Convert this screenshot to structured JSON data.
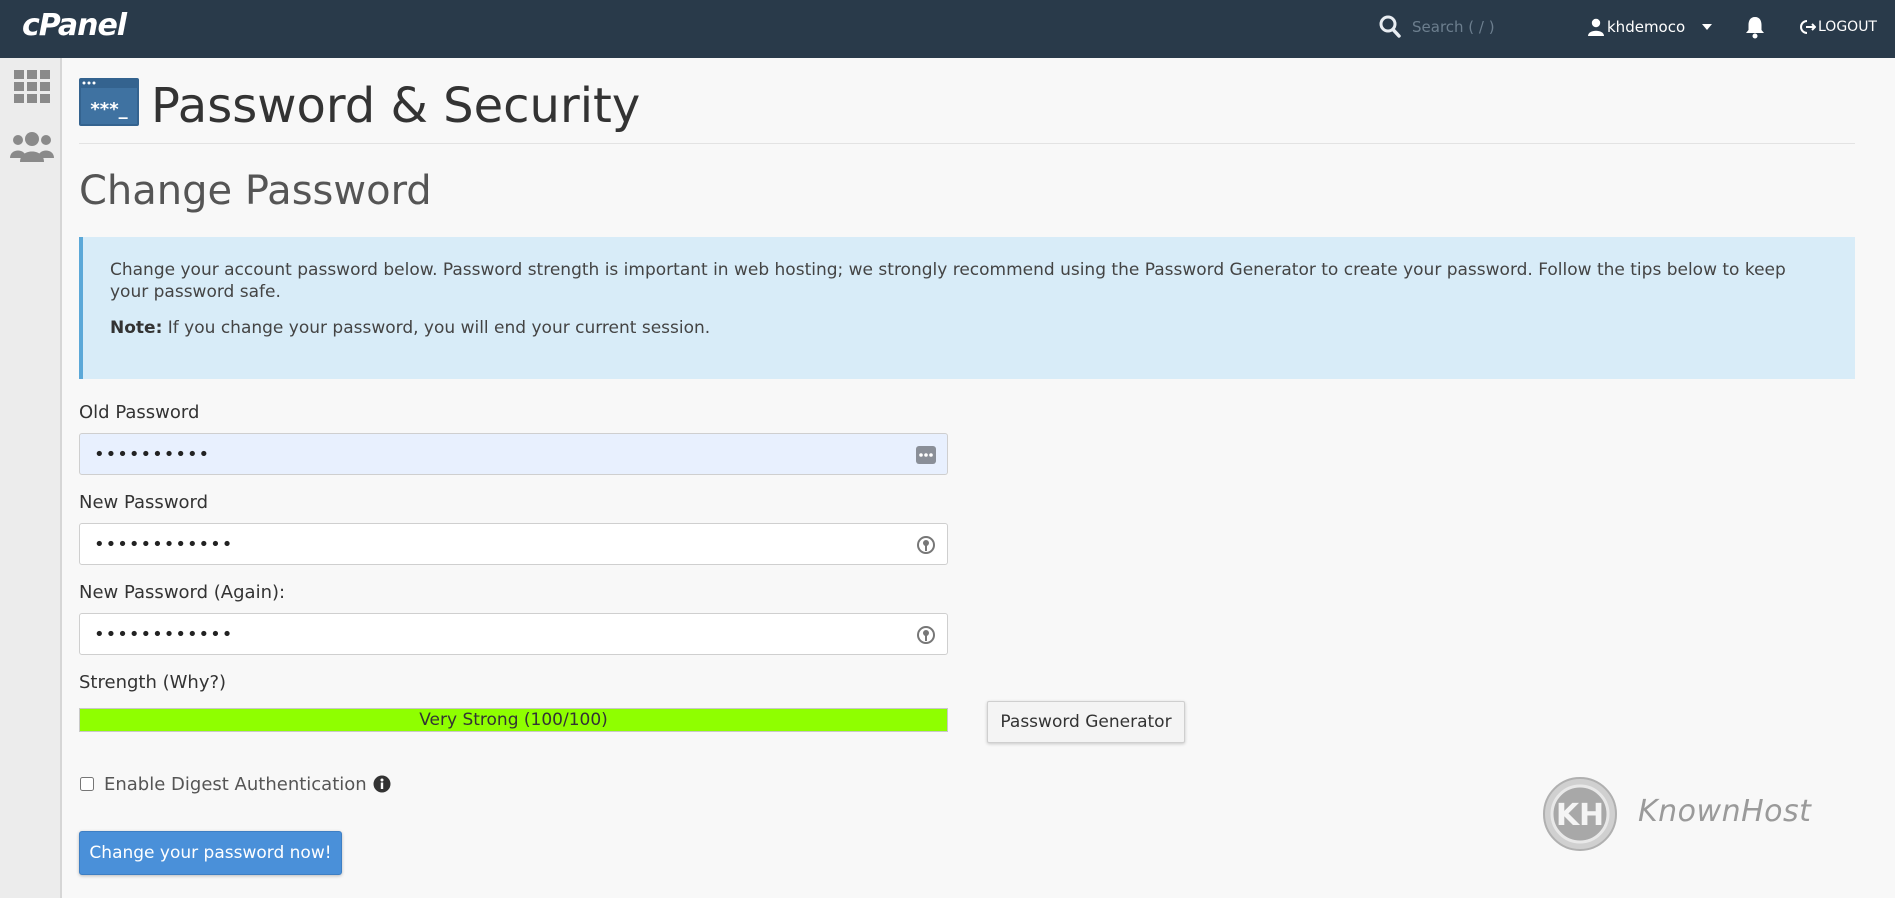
{
  "topbar": {
    "logo": "cPanel",
    "search_placeholder": "Search ( / )",
    "username": "khdemoco",
    "logout_label": "LOGOUT",
    "icons": {
      "search": "search-icon",
      "user": "user-icon",
      "caret": "caret-down-icon",
      "bell": "bell-icon",
      "logout": "logout-icon"
    }
  },
  "sidebar": {
    "items": [
      {
        "icon": "grid-icon"
      },
      {
        "icon": "users-icon"
      }
    ]
  },
  "page": {
    "title": "Password & Security",
    "icon": "password-security-icon",
    "icon_text": "***_"
  },
  "section": {
    "title": "Change Password"
  },
  "info": {
    "text": "Change your account password below. Password strength is important in web hosting; we strongly recommend using the Password Generator to create your password. Follow the tips below to keep your password safe.",
    "note_label": "Note:",
    "note_text": "If you change your password, you will end your current session."
  },
  "form": {
    "old_password": {
      "label": "Old Password",
      "value": "••••••••••"
    },
    "new_password": {
      "label": "New Password",
      "value": "••••••••••••"
    },
    "new_password_again": {
      "label": "New Password (Again):",
      "value": "••••••••••••"
    },
    "strength": {
      "label": "Strength (Why?)",
      "text": "Very Strong (100/100)",
      "fraction": 1.0,
      "color": "#8fff00"
    },
    "generator_label": "Password Generator",
    "digest_label": "Enable Digest Authentication",
    "digest_checked": false,
    "submit_label": "Change your password now!"
  },
  "watermark": {
    "brand": "KnownHost",
    "logo_text": "KH"
  },
  "colors": {
    "topbar": "#293a4a",
    "info_bg": "#d8ecf8",
    "info_border": "#5ba8d8",
    "primary_button": "#4a90d9"
  }
}
